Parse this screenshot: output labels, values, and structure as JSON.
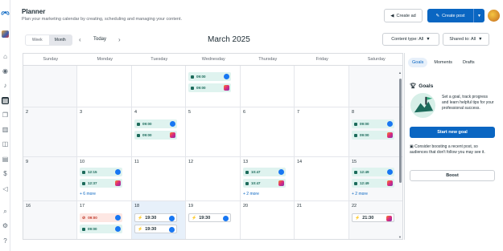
{
  "header": {
    "title": "Planner",
    "subtitle": "Plan your marketing calendar by creating, scheduling and managing your content.",
    "create_ad": "Create ad",
    "create_post": "Create post"
  },
  "toolbar": {
    "view_week": "Week",
    "view_month": "Month",
    "today": "Today",
    "month": "March 2025",
    "filter_content": "Content type: All",
    "filter_shared": "Shared to: All"
  },
  "calendar": {
    "weekdays": [
      "Sunday",
      "Monday",
      "Tuesday",
      "Wednesday",
      "Thursday",
      "Friday",
      "Saturday"
    ],
    "day_numbers": {
      "r1": [
        "2",
        "3",
        "4",
        "5",
        "6",
        "7",
        "8"
      ],
      "r2": [
        "9",
        "10",
        "11",
        "12",
        "13",
        "14",
        "15"
      ],
      "r3": [
        "16",
        "17",
        "18",
        "19",
        "20",
        "21",
        "22"
      ]
    },
    "events": {
      "wed_r0_1": "09:00",
      "wed_r0_2": "09:00",
      "tue_r1_1": "09:00",
      "tue_r1_2": "09:00",
      "sat_r1_1": "09:00",
      "sat_r1_2": "09:00",
      "mon_r2_1": "12:15",
      "mon_r2_2": "12:37",
      "thu_r2_1": "10:47",
      "thu_r2_2": "10:47",
      "sat_r2_1": "12:49",
      "sat_r2_2": "12:49",
      "mon_r3_1": "09:00",
      "mon_r3_2": "09:00",
      "tue_r3_1": "19:30",
      "tue_r3_2": "19:30",
      "wed_r3_1": "19:30",
      "sat_r3_1": "21:30"
    },
    "more": {
      "mon_r2": "+ 6 more",
      "thu_r2": "+ 2 more",
      "sat_r2": "+ 2 more"
    }
  },
  "panel": {
    "tabs": [
      "Goals",
      "Moments",
      "Drafts"
    ],
    "goals_title": "Goals",
    "goals_text": "Set a goal, track progress and learn helpful tips for your professional success.",
    "goal_button": "Start new goal",
    "boost_text": "Consider boosting a recent post, so audiences that don't follow you may see it.",
    "boost_button": "Boost"
  },
  "colors": {
    "accent": "#0a66c2",
    "event_teal": "#dff3ef",
    "today": "#e7f0fa"
  }
}
